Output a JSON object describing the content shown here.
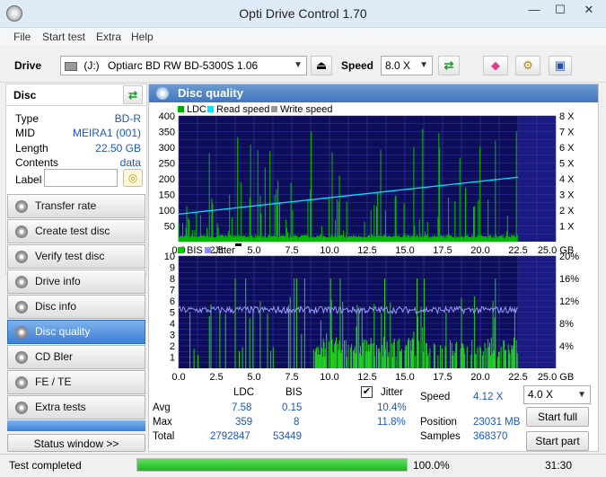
{
  "window": {
    "title": "Opti Drive Control 1.70",
    "minimize": "—",
    "maximize": "☐",
    "close": "✕"
  },
  "menu": [
    "File",
    "Start test",
    "Extra",
    "Help"
  ],
  "toolbar": {
    "drive_label": "Drive",
    "drive_letter": "(J:)",
    "drive_name": "Optiarc BD RW BD-5300S 1.06",
    "speed_label": "Speed",
    "speed_value": "8.0 X"
  },
  "disc": {
    "header": "Disc",
    "rows": [
      {
        "label": "Type",
        "value": "BD-R"
      },
      {
        "label": "MID",
        "value": "MEIRA1 (001)"
      },
      {
        "label": "Length",
        "value": "22.50 GB"
      },
      {
        "label": "Contents",
        "value": "data"
      }
    ],
    "label_field": "Label",
    "label_value": ""
  },
  "nav": [
    {
      "label": "Transfer rate",
      "active": false
    },
    {
      "label": "Create test disc",
      "active": false
    },
    {
      "label": "Verify test disc",
      "active": false
    },
    {
      "label": "Drive info",
      "active": false
    },
    {
      "label": "Disc info",
      "active": false
    },
    {
      "label": "Disc quality",
      "active": true
    },
    {
      "label": "CD Bler",
      "active": false
    },
    {
      "label": "FE / TE",
      "active": false
    },
    {
      "label": "Extra tests",
      "active": false
    }
  ],
  "status_window_button": "Status window >>",
  "panel_title": "Disc quality",
  "chart_data": [
    {
      "type": "line",
      "legend": [
        "LDC",
        "Read speed",
        "Write speed"
      ],
      "legend_colors": [
        "#00aa00",
        "#00e5ff",
        "#999999"
      ],
      "x_ticks": [
        "0.0",
        "2.5",
        "5.0",
        "7.5",
        "10.0",
        "12.5",
        "15.0",
        "17.5",
        "20.0",
        "22.5",
        "25.0 GB"
      ],
      "y_left_ticks": [
        "50",
        "100",
        "150",
        "200",
        "250",
        "300",
        "350",
        "400"
      ],
      "y_right_ticks": [
        "1 X",
        "2 X",
        "3 X",
        "4 X",
        "5 X",
        "6 X",
        "7 X",
        "8 X"
      ],
      "xlim": [
        0,
        25
      ],
      "ylim_left": [
        0,
        400
      ],
      "ylim_right": [
        0,
        8
      ],
      "data_extent_gb": 22.5,
      "ldc_baseline": 12,
      "ldc_max": 359,
      "read_speed": {
        "x": [
          0,
          22.5
        ],
        "y": [
          1.75,
          4.1
        ]
      }
    },
    {
      "type": "line",
      "legend": [
        "BIS",
        "Jitter"
      ],
      "legend_colors": [
        "#00cc00",
        "#8c8cff"
      ],
      "x_ticks": [
        "0.0",
        "2.5",
        "5.0",
        "7.5",
        "10.0",
        "12.5",
        "15.0",
        "17.5",
        "20.0",
        "22.5",
        "25.0 GB"
      ],
      "y_left_ticks": [
        "1",
        "2",
        "3",
        "4",
        "5",
        "6",
        "7",
        "8",
        "9",
        "10"
      ],
      "y_right_ticks": [
        "4%",
        "8%",
        "12%",
        "16%",
        "20%"
      ],
      "xlim": [
        0,
        25
      ],
      "ylim_left": [
        0,
        10
      ],
      "ylim_right": [
        0,
        20
      ],
      "data_extent_gb": 22.5,
      "bis_max": 8,
      "jitter_avg_pct": 10.4
    }
  ],
  "stats": {
    "col_ldc": "LDC",
    "col_bis": "BIS",
    "col_jitter": "Jitter",
    "jitter_checked": true,
    "rows": [
      {
        "label": "Avg",
        "ldc": "7.58",
        "bis": "0.15",
        "jitter": "10.4%"
      },
      {
        "label": "Max",
        "ldc": "359",
        "bis": "8",
        "jitter": "11.8%"
      },
      {
        "label": "Total",
        "ldc": "2792847",
        "bis": "53449",
        "jitter": ""
      }
    ],
    "speed_label": "Speed",
    "speed_value": "4.12 X",
    "position_label": "Position",
    "position_value": "23031 MB",
    "samples_label": "Samples",
    "samples_value": "368370",
    "test_speed": "4.0 X",
    "start_full": "Start full",
    "start_part": "Start part"
  },
  "status": {
    "text": "Test completed",
    "progress_fraction": 1.0,
    "progress_text": "100.0%",
    "time": "31:30"
  }
}
